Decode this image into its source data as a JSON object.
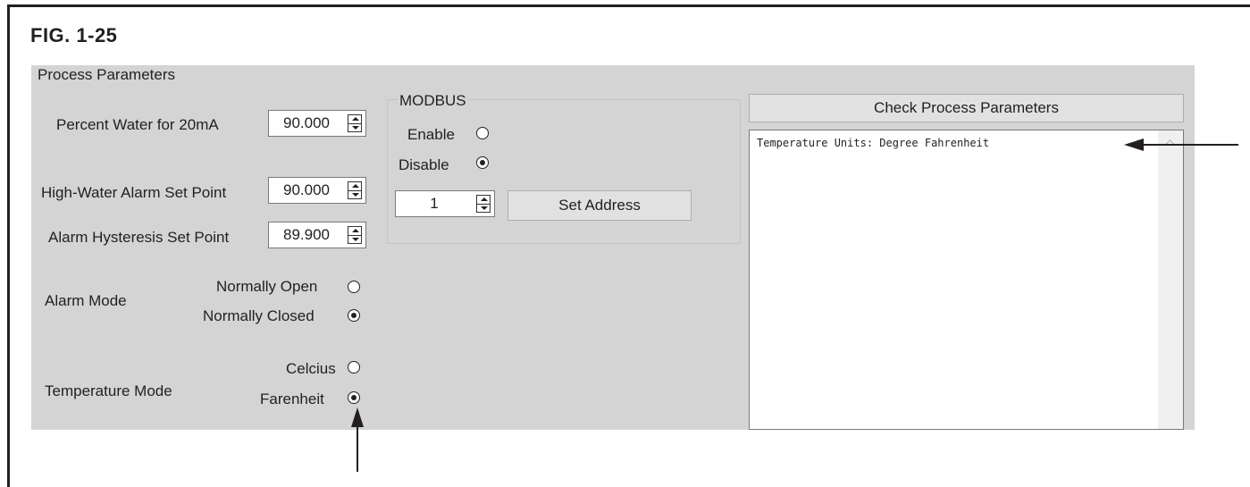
{
  "figure": {
    "title": "FIG. 1-25"
  },
  "panel": {
    "title": "Process Parameters"
  },
  "fields": {
    "percent_water": {
      "label": "Percent Water for 20mA",
      "value": "90.000"
    },
    "high_water_alarm": {
      "label": "High-Water Alarm Set Point",
      "value": "90.000"
    },
    "alarm_hysteresis": {
      "label": "Alarm Hysteresis Set Point",
      "value": "89.900"
    }
  },
  "alarm_mode": {
    "label": "Alarm Mode",
    "options": [
      {
        "label": "Normally Open",
        "selected": false
      },
      {
        "label": "Normally Closed",
        "selected": true
      }
    ]
  },
  "temperature_mode": {
    "label": "Temperature Mode",
    "options": [
      {
        "label": "Celcius",
        "selected": false
      },
      {
        "label": "Farenheit",
        "selected": true
      }
    ]
  },
  "modbus": {
    "title": "MODBUS",
    "enable_label": "Enable",
    "disable_label": "Disable",
    "enabled": false,
    "address_value": "1",
    "set_address_label": "Set Address"
  },
  "check_button": {
    "label": "Check Process Parameters"
  },
  "output": {
    "text": "Temperature Units: Degree Fahrenheit"
  },
  "icons": [
    "spinner-up-icon",
    "spinner-down-icon",
    "scroll-up-icon",
    "callout-arrow-icon"
  ]
}
